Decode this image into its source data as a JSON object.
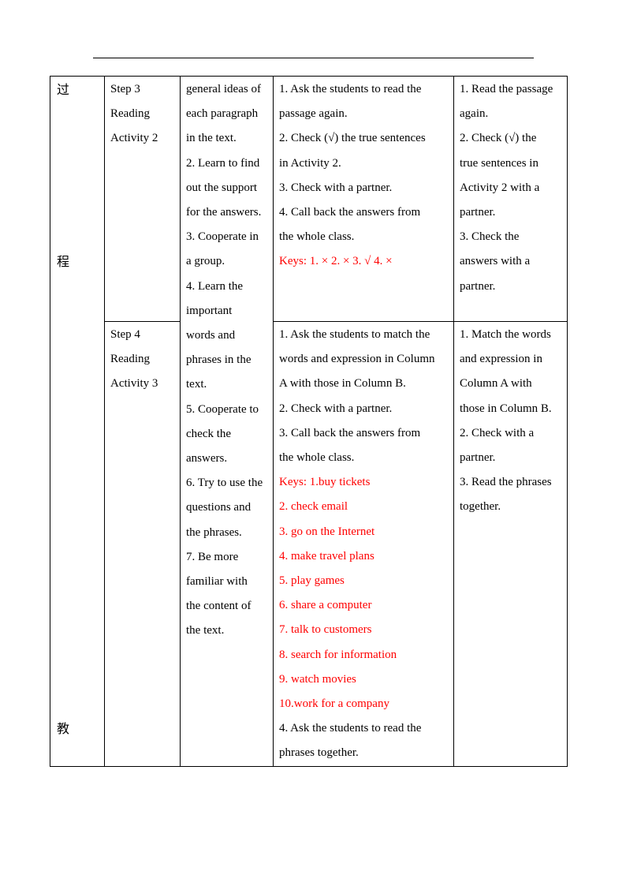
{
  "stage_chars": [
    "过",
    "程",
    "教"
  ],
  "rows": [
    {
      "step": [
        "Step 3",
        "Reading",
        "Activity 2"
      ],
      "teacher": [
        "1. Ask the students to read the",
        "passage again.",
        "2. Check (√) the true sentences",
        "in Activity 2.",
        "3. Check with a partner.",
        "4. Call back the answers from",
        "the whole class."
      ],
      "teacher_keys": [
        "Keys: 1.  ×  2.  ×  3.  √  4.  ×"
      ],
      "students": [
        "1. Read the passage",
        "again.",
        "2. Check (√) the",
        "true sentences in",
        "Activity 2 with a",
        "partner.",
        "3. Check the",
        "answers with a",
        "partner."
      ]
    },
    {
      "step": [
        "Step 4",
        "Reading",
        "Activity 3"
      ],
      "teacher": [
        "1. Ask the students to match the",
        "words and expression in Column",
        "A with those in Column B.",
        "2. Check with a partner.",
        "3. Call back the answers from",
        "the whole class."
      ],
      "teacher_keys": [
        "Keys: 1.buy tickets",
        "2. check email",
        "3. go on the Internet",
        "4. make travel plans",
        "5. play games",
        "6. share a computer",
        "7. talk to customers",
        "8. search for information",
        "9. watch movies",
        "10.work for a company"
      ],
      "teacher_after": [
        "4. Ask the students to read the",
        "phrases together."
      ],
      "students": [
        "1. Match the words",
        "and expression in",
        "Column A with",
        "those in Column B.",
        "2. Check with a",
        "partner.",
        "3. Read the phrases",
        "together."
      ]
    }
  ],
  "objectives": [
    "general ideas of",
    "each paragraph",
    "in the text.",
    "2. Learn to find",
    "out the support",
    "for the answers.",
    "3. Cooperate in",
    "a group.",
    "4. Learn the",
    "important",
    "words and",
    "phrases in the",
    "text.",
    "5. Cooperate to",
    "check the",
    "answers.",
    "6. Try to use the",
    "questions and",
    "the phrases.",
    "7. Be more",
    "familiar with",
    "the content of",
    "the text."
  ],
  "colors": {
    "keys": "#ff0000"
  }
}
